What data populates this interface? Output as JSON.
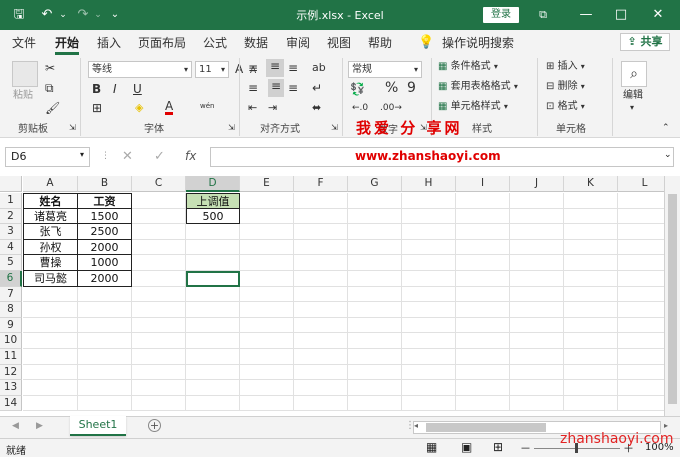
{
  "window": {
    "title": "示例.xlsx  -  Excel",
    "login": "登录",
    "minimize": "—",
    "maximize": "□",
    "close": "✕",
    "restore": "⧉"
  },
  "qat": {
    "save": "🖫",
    "undo": "↶",
    "redo": "↷",
    "more": "⌄"
  },
  "menu": [
    "文件",
    "开始",
    "插入",
    "页面布局",
    "公式",
    "数据",
    "审阅",
    "视图",
    "帮助"
  ],
  "tellme": "操作说明搜索",
  "share": "共享",
  "ribbon": {
    "clipboard": {
      "paste": "粘贴",
      "label": "剪贴板"
    },
    "font": {
      "name": "等线",
      "size": "11",
      "label": "字体",
      "bold": "B",
      "italic": "I",
      "underline": "U",
      "grow": "A",
      "shrink": "A",
      "color": "A",
      "phonetic": "wén"
    },
    "alignment": {
      "label": "对齐方式"
    },
    "number": {
      "format": "常规",
      "percent": "%",
      "comma": "9",
      "label": "数字"
    },
    "styles": {
      "conditional": "条件格式",
      "table": "套用表格格式",
      "cell": "单元格样式",
      "label": "样式"
    },
    "cells": {
      "insert": "插入",
      "delete": "删除",
      "format": "格式",
      "label": "单元格"
    },
    "editing": {
      "label": "编辑"
    }
  },
  "watermark": {
    "text": "我爱 分 享网",
    "url": "www.zhanshaoyi.com"
  },
  "formula_bar": {
    "name_box": "D6",
    "cancel": "✕",
    "enter": "✓",
    "fx": "fx",
    "value": ""
  },
  "columns": [
    "A",
    "B",
    "C",
    "D",
    "E",
    "F",
    "G",
    "H",
    "I",
    "J",
    "K",
    "L"
  ],
  "rows": [
    "1",
    "2",
    "3",
    "4",
    "5",
    "6",
    "7",
    "8",
    "9",
    "10",
    "11",
    "12",
    "13",
    "14"
  ],
  "cells": {
    "A1": "姓名",
    "B1": "工资",
    "A2": "诸葛亮",
    "B2": "1500",
    "A3": "张飞",
    "B3": "2500",
    "A4": "孙权",
    "B4": "2000",
    "A5": "曹操",
    "B5": "1000",
    "A6": "司马懿",
    "B6": "2000",
    "D1": "上调值",
    "D2": "500"
  },
  "sheets": {
    "active": "Sheet1",
    "add": "+"
  },
  "status": {
    "ready": "就绪",
    "zoom": "100%",
    "site": "zhanshaoyi.com",
    "minus": "－",
    "plus": "＋"
  },
  "colors": {
    "accent": "#217346",
    "header_fill": "#c6e0b4",
    "watermark": "#e00000"
  }
}
